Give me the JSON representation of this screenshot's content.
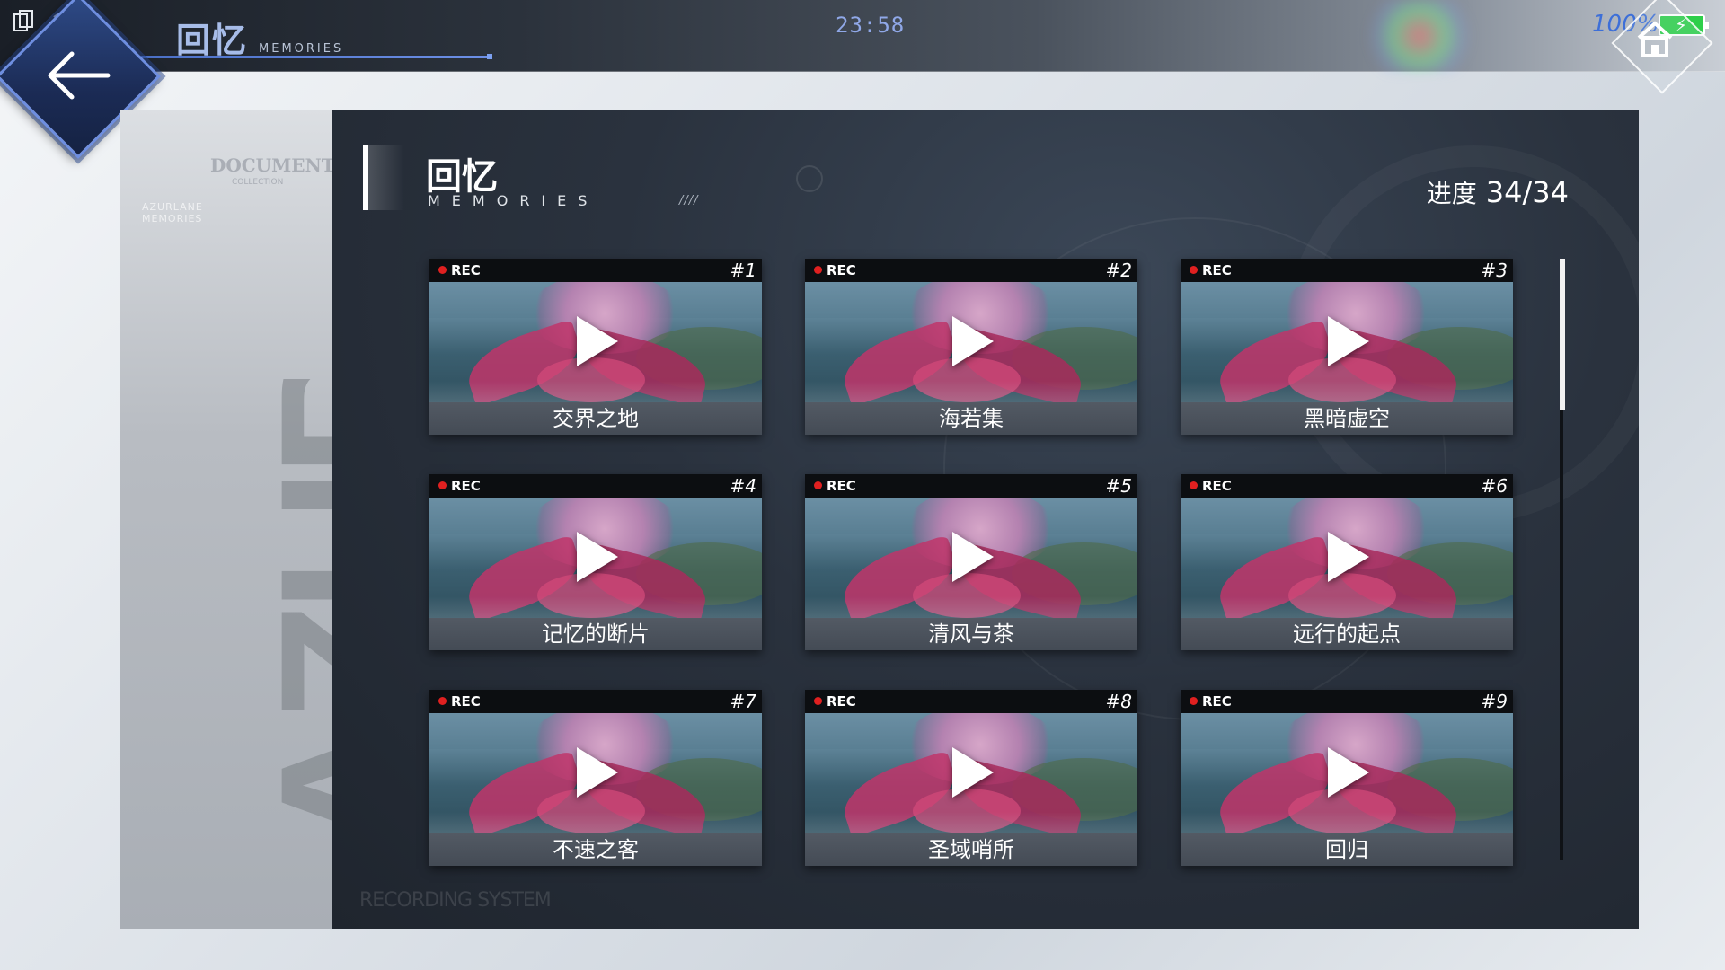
{
  "topbar": {
    "title_cn": "回忆",
    "title_en": "MEMORIES",
    "clock": "23:58",
    "battery_text": "100%",
    "battery_level": 100
  },
  "side": {
    "logo_doc": "DOCUMENT",
    "logo_collection": "COLLECTION",
    "logo_azurlane": "AZURLANE MEMORIES",
    "big_text": "AZUR"
  },
  "main": {
    "title": "回忆",
    "subtitle": "MEMORIES",
    "slashes": "////",
    "progress_label": "进度",
    "progress_value": "34/34",
    "footer": "RECORDING SYSTEM"
  },
  "cards": [
    {
      "rec": "REC",
      "num": "#1",
      "title": "交界之地"
    },
    {
      "rec": "REC",
      "num": "#2",
      "title": "海若集"
    },
    {
      "rec": "REC",
      "num": "#3",
      "title": "黑暗虚空"
    },
    {
      "rec": "REC",
      "num": "#4",
      "title": "记忆的断片"
    },
    {
      "rec": "REC",
      "num": "#5",
      "title": "清风与茶"
    },
    {
      "rec": "REC",
      "num": "#6",
      "title": "远行的起点"
    },
    {
      "rec": "REC",
      "num": "#7",
      "title": "不速之客"
    },
    {
      "rec": "REC",
      "num": "#8",
      "title": "圣域哨所"
    },
    {
      "rec": "REC",
      "num": "#9",
      "title": "回归"
    }
  ],
  "colors": {
    "accent": "#6e8ee0",
    "rec_dot": "#e02020",
    "battery": "#2ecf4a"
  },
  "icons": {
    "back": "back-arrow-icon",
    "home": "home-icon",
    "play": "play-icon",
    "copy": "copy-icon",
    "wifi": "wifi-icon"
  }
}
